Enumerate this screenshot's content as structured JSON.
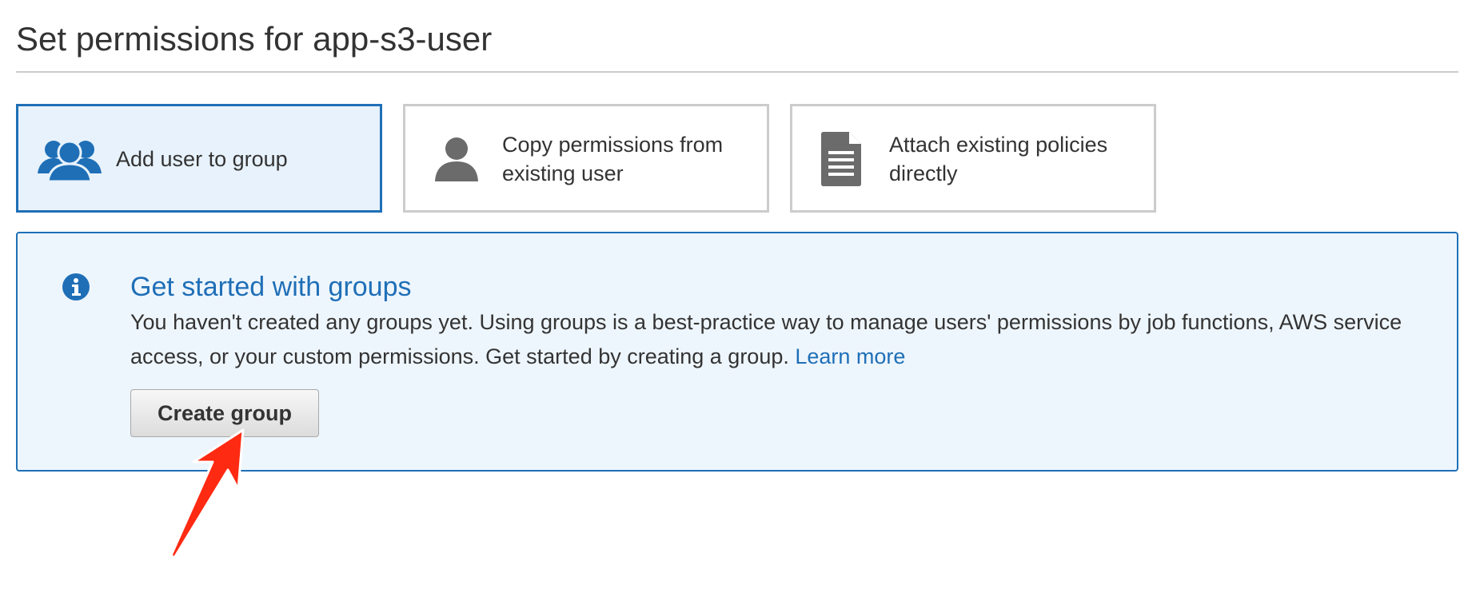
{
  "page": {
    "title": "Set permissions for app-s3-user"
  },
  "options": [
    {
      "label": "Add user to group",
      "icon": "users-group-icon",
      "selected": true
    },
    {
      "label": "Copy permissions from existing user",
      "icon": "user-icon",
      "selected": false
    },
    {
      "label": "Attach existing policies directly",
      "icon": "document-icon",
      "selected": false
    }
  ],
  "info_panel": {
    "icon": "info-icon",
    "heading": "Get started with groups",
    "body": "You haven't created any groups yet. Using groups is a best-practice way to manage users' permissions by job functions, AWS service access, or your custom permissions. Get started by creating a group. ",
    "link_label": "Learn more",
    "button_label": "Create group"
  },
  "annotation": {
    "icon": "red-arrow-icon",
    "color": "#ff2a12"
  },
  "colors": {
    "accent": "#1f6fb7",
    "selected_bg": "#e7f2fc",
    "panel_bg": "#eef6fd",
    "icon_gray": "#6b6b6b"
  }
}
